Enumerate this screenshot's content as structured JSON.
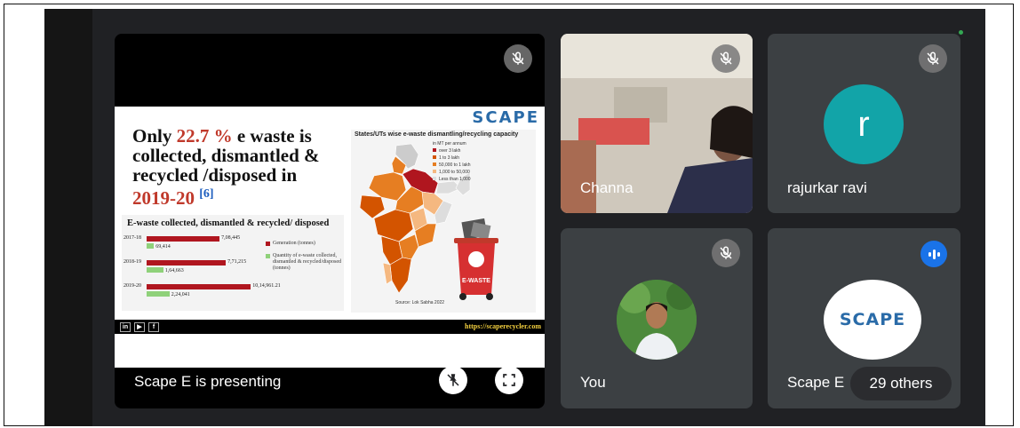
{
  "presentation": {
    "label": "Scape E is presenting",
    "slide": {
      "brand": "SCAPE",
      "title_part1": "Only ",
      "title_highlight": "22.7 %",
      "title_part2": " e waste is collected, dismantled & recycled /disposed in ",
      "title_year": "2019-20",
      "title_ref": "[6]",
      "chart": {
        "title": "E-waste collected, dismantled & recycled/ disposed",
        "rows": [
          {
            "year": "2017-18",
            "generation": "7,08,445",
            "collected": "69,414",
            "gen_frac": 0.7,
            "col_frac": 0.07
          },
          {
            "year": "2018-19",
            "generation": "7,71,215",
            "collected": "1,64,663",
            "gen_frac": 0.76,
            "col_frac": 0.16
          },
          {
            "year": "2019-20",
            "generation": "10,14,961.21",
            "collected": "2,24,041",
            "gen_frac": 1.0,
            "col_frac": 0.22
          }
        ],
        "legend_generation": "Generation (tonnes)",
        "legend_collected": "Quantity of e-waste collected, dismantled & recycled/disposed (tonnes)",
        "colors": {
          "generation": "#b0161f",
          "collected": "#8fd17a"
        }
      },
      "map": {
        "title": "States/UTs wise e-waste dismantling/recycling capacity",
        "unit": "in MT per annum",
        "legend": [
          "over 3 lakh",
          "1 to 3 lakh",
          "50,000 to 1 lakh",
          "1,000 to 50,000",
          "Less than 1,000"
        ],
        "legend_colors": [
          "#b0161f",
          "#d35400",
          "#e67e22",
          "#f5b880",
          "#dddddd"
        ],
        "bin_label": "E-WASTE",
        "source": "Source: Lok Sabha 2022"
      },
      "social": [
        "in",
        "▶",
        "f"
      ],
      "url": "https://scaperecycler.com"
    }
  },
  "participants": [
    {
      "name": "Channa",
      "muted": true
    },
    {
      "name": "rajurkar ravi",
      "initial": "r",
      "muted": true
    },
    {
      "name": "You",
      "muted": true
    },
    {
      "name": "Scape E",
      "speaking": true,
      "logo": "SCAPE"
    }
  ],
  "others_count": "29 others"
}
